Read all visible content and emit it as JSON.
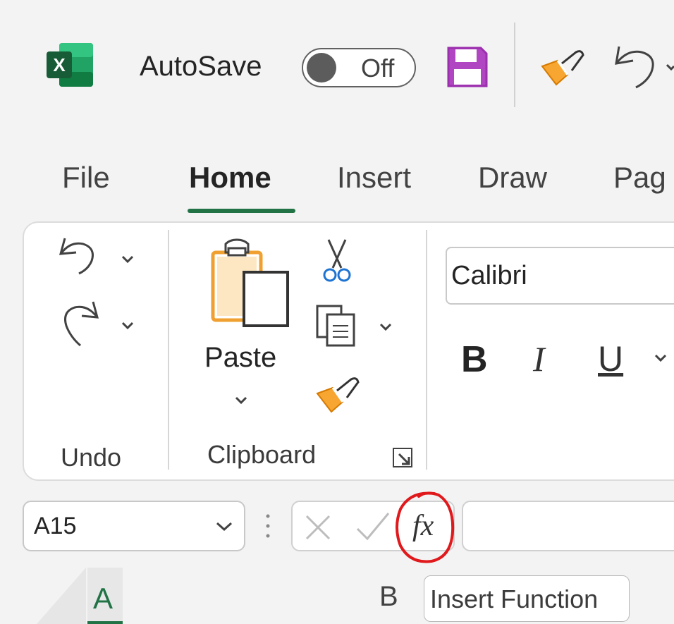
{
  "title_bar": {
    "app_icon_letter": "X",
    "autosave_label": "AutoSave",
    "autosave_state": "Off"
  },
  "tabs": [
    {
      "label": "File",
      "active": false
    },
    {
      "label": "Home",
      "active": true
    },
    {
      "label": "Insert",
      "active": false
    },
    {
      "label": "Draw",
      "active": false
    },
    {
      "label": "Pag",
      "active": false
    }
  ],
  "ribbon": {
    "undo_group": {
      "label": "Undo"
    },
    "clipboard_group": {
      "label": "Clipboard",
      "paste_label": "Paste"
    },
    "font_group": {
      "font_name": "Calibri",
      "bold": "B",
      "italic": "I",
      "underline": "U"
    }
  },
  "formula_bar": {
    "name_box_value": "A15",
    "fx_label": "fx",
    "formula_value": ""
  },
  "grid": {
    "columns": [
      "A",
      "B"
    ]
  },
  "tooltip": {
    "text": "Insert Function"
  },
  "colors": {
    "excel_green": "#217346",
    "save_purple": "#b146c2",
    "brush_orange": "#f7a632",
    "annotation_red": "#e0191c"
  }
}
